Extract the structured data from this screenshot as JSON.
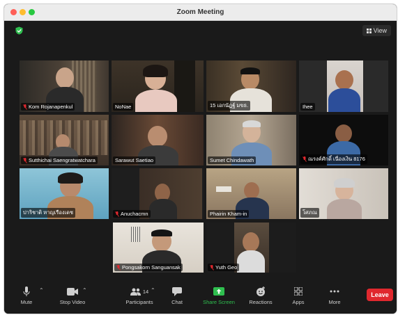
{
  "window": {
    "title": "Zoom Meeting"
  },
  "header": {
    "view_label": "View"
  },
  "participants": [
    {
      "name": "Kom Rojanapenkul",
      "muted": true
    },
    {
      "name": "NoNae",
      "muted": false,
      "speaking": true
    },
    {
      "name": "15 เอกนัฏฐ์ มขธ.",
      "muted": false
    },
    {
      "name": "Ihee",
      "muted": false
    },
    {
      "name": "Sutthichai Saengratwatchara",
      "muted": true
    },
    {
      "name": "Sarawut Saetiao",
      "muted": false
    },
    {
      "name": "Sumet Chindawath",
      "muted": false
    },
    {
      "name": "ณรงค์ศักดิ์ เนื่องเงิน 8176",
      "muted": true
    },
    {
      "name": "ปาริชาติ หาญเรืองเดช",
      "muted": false
    },
    {
      "name": "Anuchacmn",
      "muted": true
    },
    {
      "name": "Phairin  Kham-in",
      "muted": false
    },
    {
      "name": "โศภณ",
      "muted": false
    },
    {
      "name": "Pongsakorn Sanguansak",
      "muted": true
    },
    {
      "name": "Yuth Geo",
      "muted": true
    }
  ],
  "toolbar": {
    "mute": "Mute",
    "stop_video": "Stop Video",
    "participants": "Participants",
    "participants_count": "14",
    "chat": "Chat",
    "share_screen": "Share Screen",
    "reactions": "Reactions",
    "apps": "Apps",
    "more": "More",
    "leave": "Leave"
  },
  "colors": {
    "speaking_outline": "#c7e34a",
    "leave": "#e0282e",
    "share": "#2fbf4f"
  }
}
